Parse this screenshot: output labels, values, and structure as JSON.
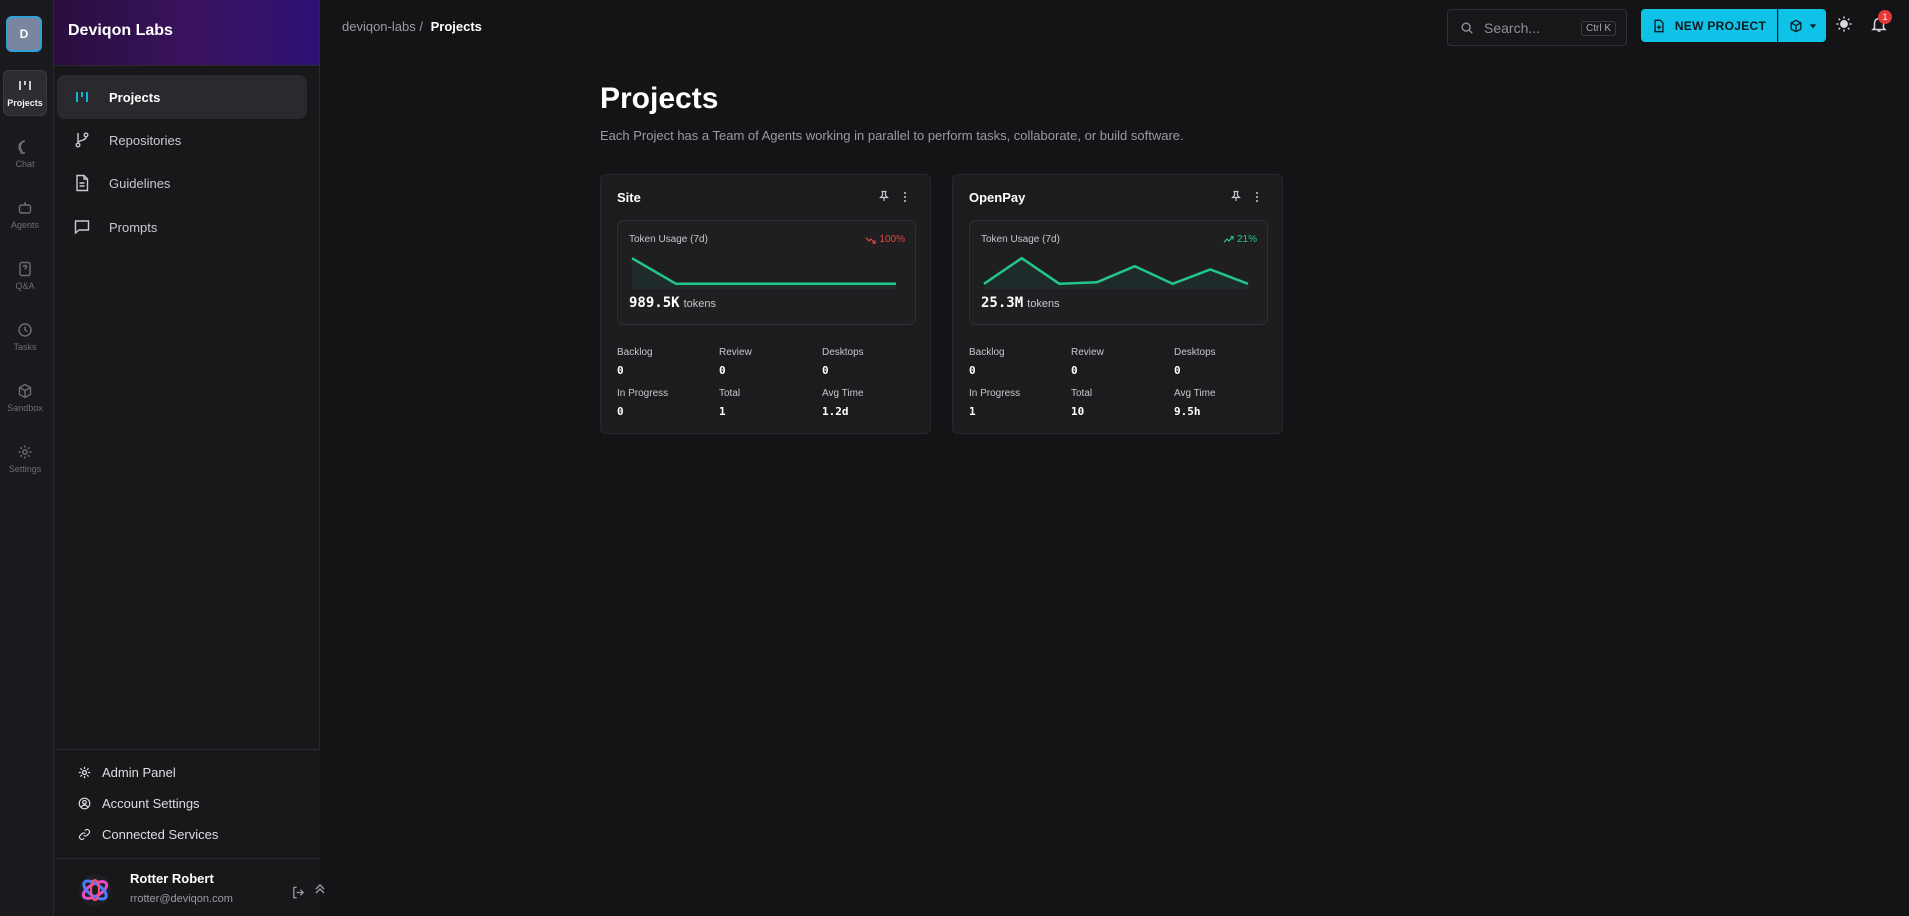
{
  "workspace": {
    "initial": "D",
    "name": "Deviqon Labs"
  },
  "rail": [
    {
      "label": "Projects",
      "icon": "projects-icon",
      "active": true
    },
    {
      "label": "Chat",
      "icon": "chat-icon"
    },
    {
      "label": "Agents",
      "icon": "robot-icon"
    },
    {
      "label": "Q&A",
      "icon": "question-doc-icon"
    },
    {
      "label": "Tasks",
      "icon": "clock-icon"
    },
    {
      "label": "Sandbox",
      "icon": "cube-icon"
    },
    {
      "label": "Settings",
      "icon": "gear-icon"
    }
  ],
  "nav": [
    {
      "label": "Projects",
      "icon": "projects-icon",
      "active": true
    },
    {
      "label": "Repositories",
      "icon": "git-branch-icon"
    },
    {
      "label": "Guidelines",
      "icon": "document-icon"
    },
    {
      "label": "Prompts",
      "icon": "message-square-icon"
    }
  ],
  "footer_links": [
    {
      "label": "Admin Panel",
      "icon": "gear-icon"
    },
    {
      "label": "Account Settings",
      "icon": "user-circle-icon"
    },
    {
      "label": "Connected Services",
      "icon": "link-icon"
    }
  ],
  "user": {
    "name": "Rotter Robert",
    "email": "rrotter@deviqon.com"
  },
  "breadcrumb": {
    "root": "deviqon-labs",
    "separator": "/",
    "current": "Projects"
  },
  "search": {
    "placeholder": "Search...",
    "shortcut": "Ctrl K"
  },
  "new_project_label": "NEW PROJECT",
  "notifications_count": "1",
  "page": {
    "title": "Projects",
    "subtitle": "Each Project has a Team of Agents working in parallel to perform tasks, collaborate, or build software."
  },
  "accent_color": "#0fc3e8",
  "cards": [
    {
      "name": "Site",
      "usage_label": "Token Usage (7d)",
      "trend": "100%",
      "trend_direction": "down",
      "trend_color": "#e5483d",
      "spark": [
        9,
        1,
        1,
        1,
        1,
        1,
        1
      ],
      "tokens": "989.5K",
      "tokens_unit": "tokens",
      "stats": [
        {
          "label": "Backlog",
          "value": "0"
        },
        {
          "label": "Review",
          "value": "0"
        },
        {
          "label": "Desktops",
          "value": "0"
        },
        {
          "label": "In Progress",
          "value": "0"
        },
        {
          "label": "Total",
          "value": "1"
        },
        {
          "label": "Avg Time",
          "value": "1.2d"
        }
      ]
    },
    {
      "name": "OpenPay",
      "usage_label": "Token Usage (7d)",
      "trend": "21%",
      "trend_direction": "up",
      "trend_color": "#22c58b",
      "spark": [
        1,
        9,
        1,
        1.5,
        6.5,
        1,
        5.5,
        1
      ],
      "tokens": "25.3M",
      "tokens_unit": "tokens",
      "stats": [
        {
          "label": "Backlog",
          "value": "0"
        },
        {
          "label": "Review",
          "value": "0"
        },
        {
          "label": "Desktops",
          "value": "0"
        },
        {
          "label": "In Progress",
          "value": "1"
        },
        {
          "label": "Total",
          "value": "10"
        },
        {
          "label": "Avg Time",
          "value": "9.5h"
        }
      ]
    }
  ]
}
